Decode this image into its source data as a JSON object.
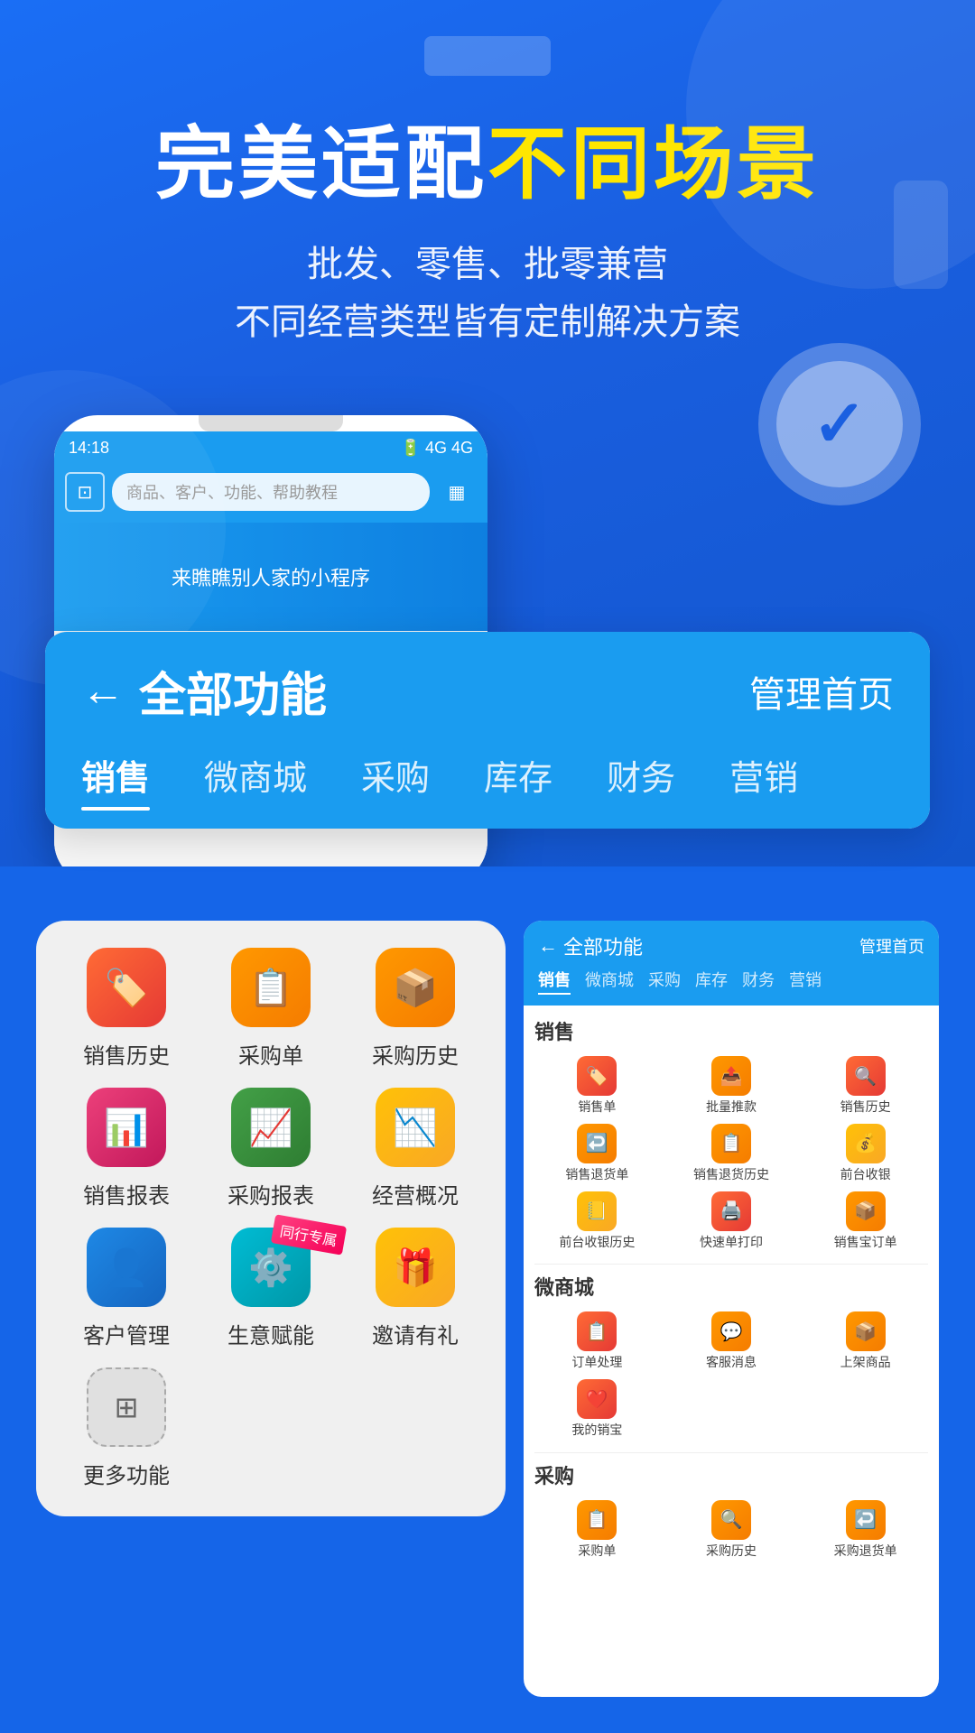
{
  "hero": {
    "title_white": "完美适配",
    "title_yellow": "不同场景",
    "subtitle_line1": "批发、零售、批零兼营",
    "subtitle_line2": "不同经营类型皆有定制解决方案"
  },
  "status_bar": {
    "time": "14:18",
    "signals": "🔋 4G 4G"
  },
  "phone_search": {
    "placeholder": "商品、客户、功能、帮助教程",
    "scan_label": "扫一扫",
    "qr_label": "收款码"
  },
  "phone_banner": {
    "text": "来瞧瞧别人家的小程序"
  },
  "function_panel": {
    "back_label": "←",
    "title": "全部功能",
    "right_label": "管理首页",
    "tabs": [
      {
        "label": "销售",
        "active": true
      },
      {
        "label": "微商城",
        "active": false
      },
      {
        "label": "采购",
        "active": false
      },
      {
        "label": "库存",
        "active": false
      },
      {
        "label": "财务",
        "active": false
      },
      {
        "label": "营销",
        "active": false
      }
    ]
  },
  "left_icons": [
    {
      "label": "销售历史",
      "color": "ic-red",
      "emoji": "🏷️"
    },
    {
      "label": "采购单",
      "color": "ic-orange",
      "emoji": "📋"
    },
    {
      "label": "采购历史",
      "color": "ic-orange",
      "emoji": "📦"
    },
    {
      "label": "销售报表",
      "color": "ic-pink",
      "emoji": "📊"
    },
    {
      "label": "采购报表",
      "color": "ic-green",
      "emoji": "📈"
    },
    {
      "label": "经营概况",
      "color": "ic-yellow",
      "emoji": "📉"
    },
    {
      "label": "客户管理",
      "color": "ic-blue",
      "emoji": "👤"
    },
    {
      "label": "生意赋能",
      "color": "ic-teal",
      "emoji": "⚙️",
      "badge": true
    },
    {
      "label": "邀请有礼",
      "color": "ic-yellow",
      "emoji": "🎁"
    },
    {
      "label": "更多功能",
      "color": "ic-gray",
      "emoji": "⊞"
    }
  ],
  "right_phone": {
    "header_title": "← 全部功能",
    "header_right": "管理首页",
    "tabs": [
      "销售",
      "微商城",
      "采购",
      "库存",
      "财务",
      "营销"
    ],
    "active_tab": "销售",
    "sections": [
      {
        "title": "销售",
        "icons": [
          {
            "label": "销售单",
            "color": "ic-red",
            "emoji": "🏷️"
          },
          {
            "label": "批量推款",
            "color": "ic-orange",
            "emoji": "📤"
          },
          {
            "label": "销售历史",
            "color": "ic-red",
            "emoji": "🔍"
          },
          {
            "label": "销售退货单",
            "color": "ic-orange",
            "emoji": "↩️"
          },
          {
            "label": "销售退货历史",
            "color": "ic-orange",
            "emoji": "📋"
          },
          {
            "label": "前台收银",
            "color": "ic-yellow",
            "emoji": "💰"
          },
          {
            "label": "前台收银历史",
            "color": "ic-yellow",
            "emoji": "📒"
          },
          {
            "label": "快速单打印",
            "color": "ic-red",
            "emoji": "🖨️"
          },
          {
            "label": "销售宝订单",
            "color": "ic-orange",
            "emoji": "📦"
          }
        ]
      },
      {
        "title": "微商城",
        "icons": [
          {
            "label": "订单处理",
            "color": "ic-red",
            "emoji": "📋"
          },
          {
            "label": "客服消息",
            "color": "ic-orange",
            "emoji": "💬"
          },
          {
            "label": "上架商品",
            "color": "ic-orange",
            "emoji": "📦"
          },
          {
            "label": "我的销宝",
            "color": "ic-red",
            "emoji": "❤️"
          }
        ]
      },
      {
        "title": "采购",
        "icons": [
          {
            "label": "采购单",
            "color": "ic-orange",
            "emoji": "📋"
          },
          {
            "label": "采购历史",
            "color": "ic-orange",
            "emoji": "🔍"
          },
          {
            "label": "采购退货单",
            "color": "ic-orange",
            "emoji": "↩️"
          }
        ]
      }
    ]
  }
}
